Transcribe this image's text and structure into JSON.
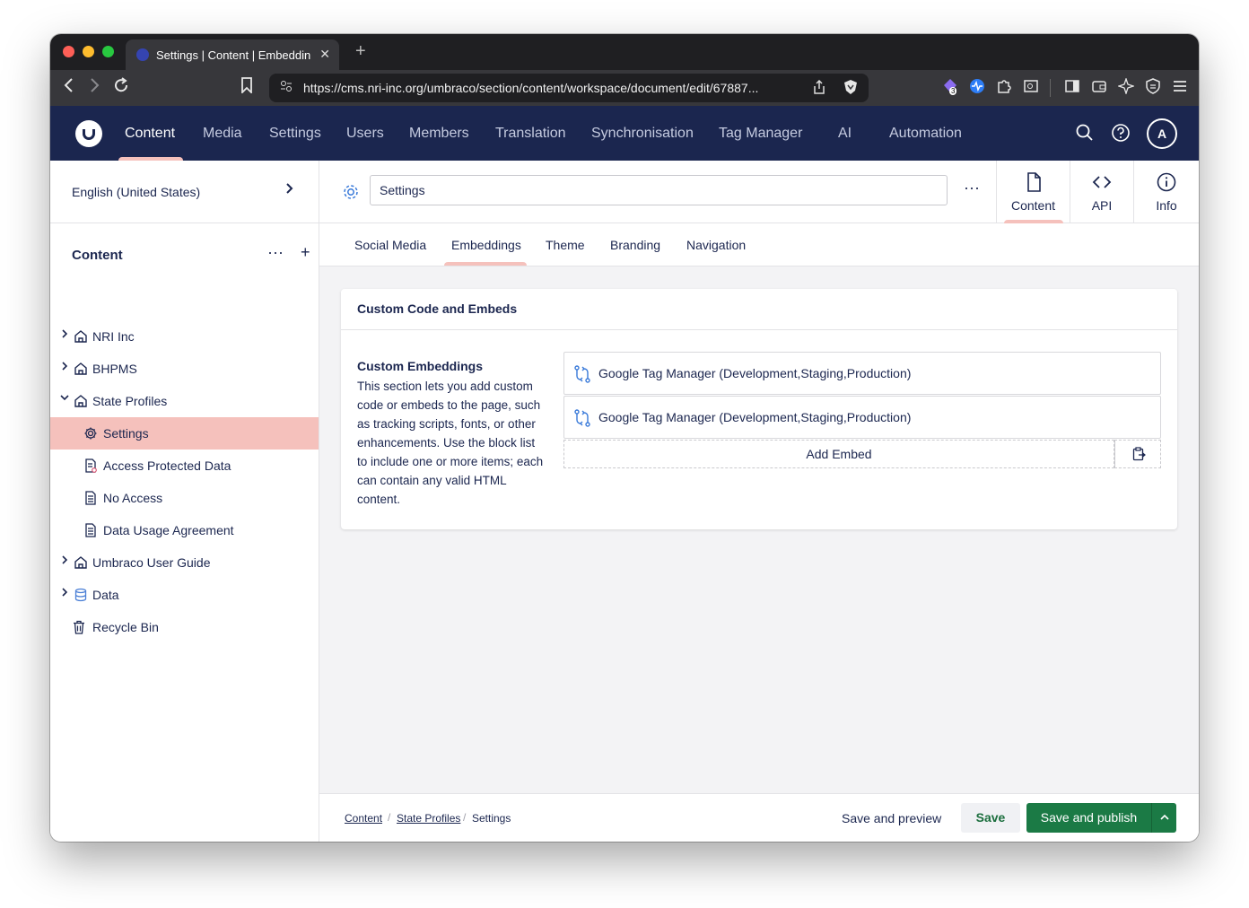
{
  "browser": {
    "tab_title": "Settings | Content | Embeddings",
    "tab_close": "✕",
    "new_tab": "+",
    "url": "https://cms.nri-inc.org/umbraco/section/content/workspace/document/edit/67887...",
    "extension_badge": "3"
  },
  "header": {
    "sections": [
      "Content",
      "Media",
      "Settings",
      "Users",
      "Members",
      "Translation",
      "Synchronisation",
      "Tag Manager",
      "AI",
      "Automation"
    ],
    "active_section": "Content",
    "avatar_initial": "A"
  },
  "sidebar": {
    "culture": "English (United States)",
    "tree_title": "Content",
    "tree_more": "···",
    "tree_add": "+",
    "items": [
      {
        "label": "NRI Inc",
        "icon": "home-icon",
        "expand": "closed"
      },
      {
        "label": "BHPMS",
        "icon": "home-icon",
        "expand": "closed"
      },
      {
        "label": "State Profiles",
        "icon": "home-icon",
        "expand": "open"
      },
      {
        "label": "Settings",
        "icon": "gear-icon",
        "active": true
      },
      {
        "label": "Access Protected Data",
        "icon": "document-locked-icon"
      },
      {
        "label": "No Access",
        "icon": "document-icon"
      },
      {
        "label": "Data Usage Agreement",
        "icon": "document-icon"
      },
      {
        "label": "Umbraco User Guide",
        "icon": "home-icon",
        "expand": "closed"
      },
      {
        "label": "Data",
        "icon": "database-icon",
        "expand": "closed"
      },
      {
        "label": "Recycle Bin",
        "icon": "trash-icon"
      }
    ]
  },
  "document": {
    "name": "Settings",
    "more": "···",
    "views": [
      {
        "label": "Content",
        "icon": "document-icon",
        "active": true
      },
      {
        "label": "API",
        "icon": "code-icon"
      },
      {
        "label": "Info",
        "icon": "info-icon"
      }
    ],
    "tabs": [
      "Social Media",
      "Embeddings",
      "Theme",
      "Branding",
      "Navigation"
    ],
    "active_tab": "Embeddings",
    "group_title": "Custom Code and Embeds",
    "property": {
      "label": "Custom Embeddings",
      "description": "This section lets you add custom code or embeds to the page, such as tracking scripts, fonts, or other enhancements. Use the block list to include one or more items; each can contain any valid HTML content."
    },
    "blocks": [
      {
        "label": "Google Tag Manager (Development,Staging,Production)",
        "icon": "code-branch-icon"
      },
      {
        "label": "Google Tag Manager (Development,Staging,Production)",
        "icon": "code-branch-icon"
      }
    ],
    "add_embed": "Add Embed"
  },
  "footer": {
    "breadcrumbs": [
      "Content",
      "State Profiles",
      "Settings"
    ],
    "breadcrumb_separator": "/",
    "save_preview": "Save and preview",
    "save": "Save",
    "save_publish": "Save and publish",
    "caret": "^"
  },
  "colors": {
    "header_bg": "#1b264f",
    "active_highlight": "#f5c1bc",
    "publish_green": "#1b7a45"
  }
}
